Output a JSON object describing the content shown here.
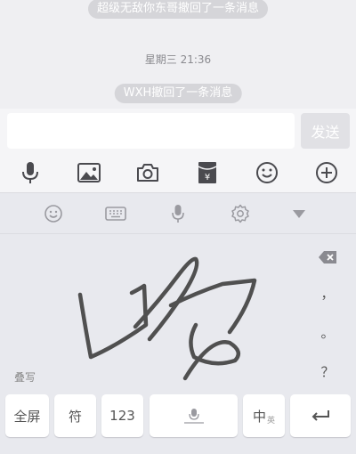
{
  "chat": {
    "recall_notice_1": "超级无敌你东哥撤回了一条消息",
    "timestamp": "星期三 21:36",
    "recall_notice_2": "WXH撤回了一条消息"
  },
  "input": {
    "value": "",
    "send_label": "发送"
  },
  "toolbar": {
    "items": [
      "microphone-icon",
      "image-icon",
      "camera-icon",
      "red-packet-icon",
      "emoji-icon",
      "plus-icon"
    ],
    "red_packet_symbol": "¥"
  },
  "keyboard": {
    "top_icons": [
      "emoji-icon",
      "keyboard-icon",
      "microphone-icon",
      "settings-icon",
      "collapse-triangle-icon"
    ],
    "side_keys": {
      "comma": "，",
      "period": "。",
      "question": "？"
    },
    "overlap_label": "叠写",
    "bottom_keys": {
      "fullscreen": "全屏",
      "symbols": "符",
      "numbers": "123",
      "lang_main": "中",
      "lang_sub": "英"
    },
    "colors": {
      "ink": "#505050",
      "send_disabled": "#e1e1e5"
    }
  }
}
